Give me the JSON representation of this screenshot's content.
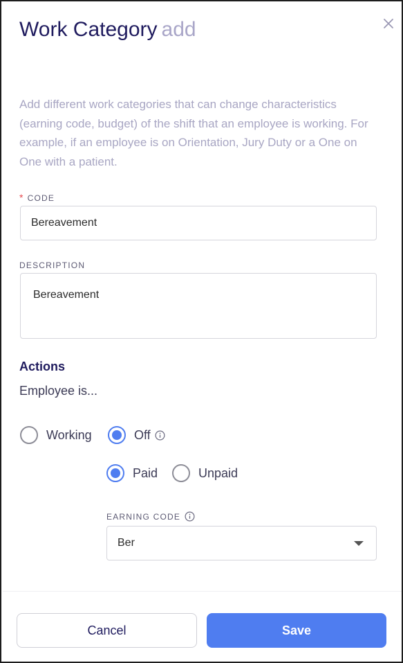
{
  "header": {
    "title": "Work Category",
    "mode": "add",
    "close_icon": "close-icon"
  },
  "intro": "Add different work categories that can change characteristics (earning code, budget) of the shift that an employee is working. For example, if an employee is on Orientation, Jury Duty or a One on One with a patient.",
  "code": {
    "required_marker": "*",
    "label": "CODE",
    "value": "Bereavement"
  },
  "description": {
    "label": "DESCRIPTION",
    "value": "Bereavement"
  },
  "actions": {
    "title": "Actions",
    "subtitle": "Employee is...",
    "status_options": [
      {
        "label": "Working",
        "checked": false
      },
      {
        "label": "Off",
        "checked": true
      }
    ],
    "pay_options": [
      {
        "label": "Paid",
        "checked": true
      },
      {
        "label": "Unpaid",
        "checked": false
      }
    ]
  },
  "earning_code": {
    "label": "EARNING CODE",
    "value": "Ber"
  },
  "footer": {
    "cancel_label": "Cancel",
    "save_label": "Save"
  },
  "colors": {
    "accent": "#4f7df0",
    "title": "#1f1b5e",
    "required": "#e5484d"
  }
}
